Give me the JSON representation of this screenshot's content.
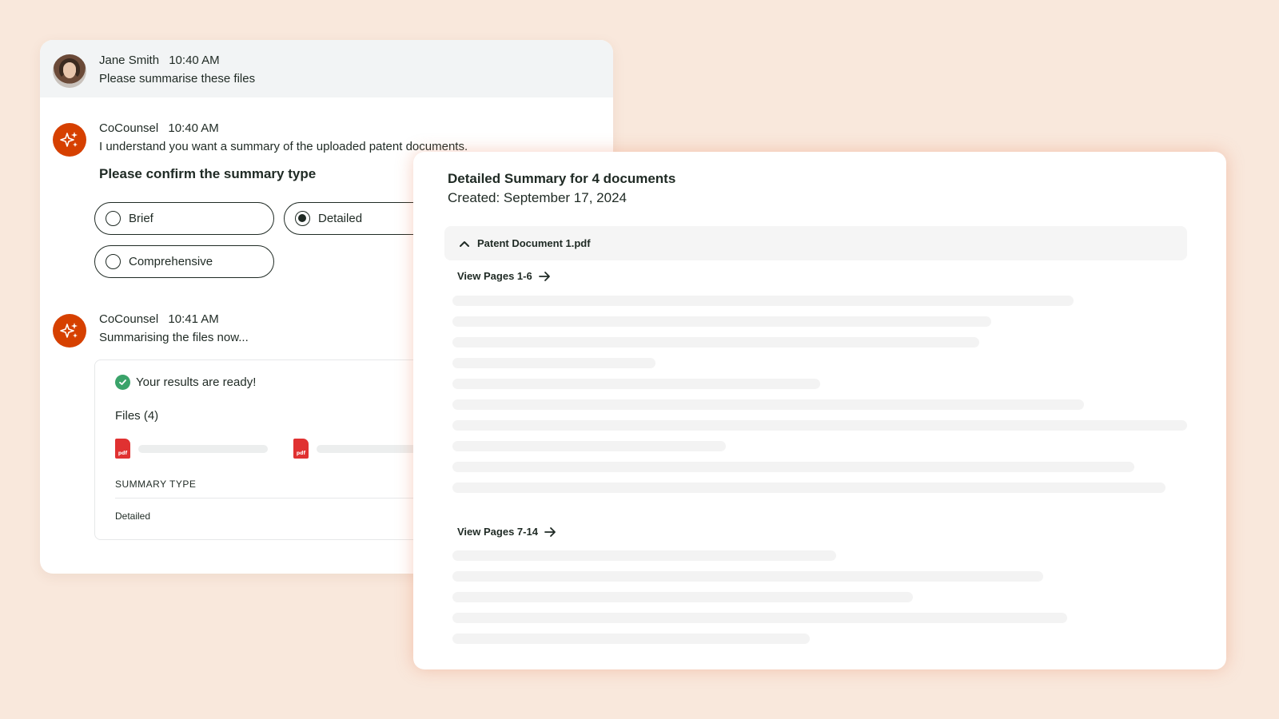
{
  "chat": {
    "user_message": {
      "name": "Jane Smith",
      "time": "10:40 AM",
      "text": "Please summarise these files"
    },
    "bot_message_1": {
      "name": "CoCounsel",
      "time": "10:40 AM",
      "text": "I understand you want a summary of the uploaded patent documents."
    },
    "confirm_title": "Please confirm the summary type",
    "options": [
      {
        "label": "Brief",
        "selected": false
      },
      {
        "label": "Detailed",
        "selected": true
      },
      {
        "label": "Comprehensive",
        "selected": false
      }
    ],
    "bot_message_2": {
      "name": "CoCounsel",
      "time": "10:41 AM",
      "text": "Summarising the files now..."
    },
    "results": {
      "ready_text": "Your results are ready!",
      "files_label": "Files (4)",
      "file_icon_text": "pdf",
      "summary_type_label": "SUMMARY TYPE",
      "summary_type_value": "Detailed"
    }
  },
  "summary": {
    "title": "Detailed Summary for 4 documents",
    "created": "Created: September 17, 2024",
    "document": {
      "name": "Patent Document 1.pdf",
      "expanded": true
    },
    "sections": [
      {
        "label": "View Pages 1-6"
      },
      {
        "label": "View Pages 7-14"
      }
    ]
  },
  "colors": {
    "background": "#f9e8dc",
    "brand_orange": "#d64000",
    "success_green": "#3aa36a",
    "pdf_red": "#e03131",
    "text_dark": "#1f2a24"
  },
  "icons": {
    "user_avatar": "user-avatar",
    "bot_avatar": "sparkle-icon",
    "ready": "check-circle-icon",
    "file": "pdf-file-icon",
    "collapse": "chevron-up-icon",
    "view_link": "arrow-right-icon"
  }
}
